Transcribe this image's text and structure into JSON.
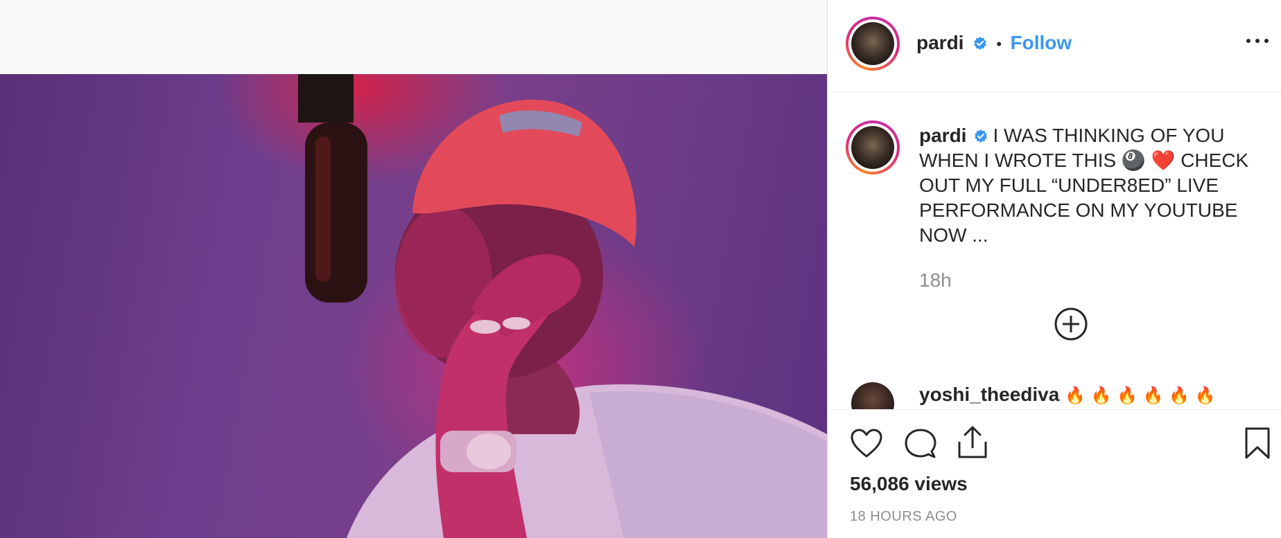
{
  "post": {
    "username": "pardi",
    "separator": "•",
    "follow_label": "Follow",
    "caption_text": "I WAS THINKING OF YOU WHEN I WROTE THIS 🎱 ❤️ CHECK OUT MY FULL “UNDER8ED” LIVE PERFORMANCE ON MY YOUTUBE NOW ...",
    "time_ago": "18h"
  },
  "comments": [
    {
      "username": "yoshi_theediva",
      "text": "🔥 🔥 🔥 🔥 🔥 🔥"
    }
  ],
  "stats": {
    "views": "56,086 views",
    "posted": "18 HOURS AGO"
  },
  "icons": {
    "verified": "verified-badge-icon",
    "more": "more-options-icon",
    "load_more": "plus-circle-icon",
    "like": "heart-icon",
    "comment": "comment-bubble-icon",
    "share": "share-icon",
    "save": "bookmark-icon"
  },
  "colors": {
    "accent": "#3897f0",
    "text": "#262626",
    "muted": "#8e8e8e"
  }
}
